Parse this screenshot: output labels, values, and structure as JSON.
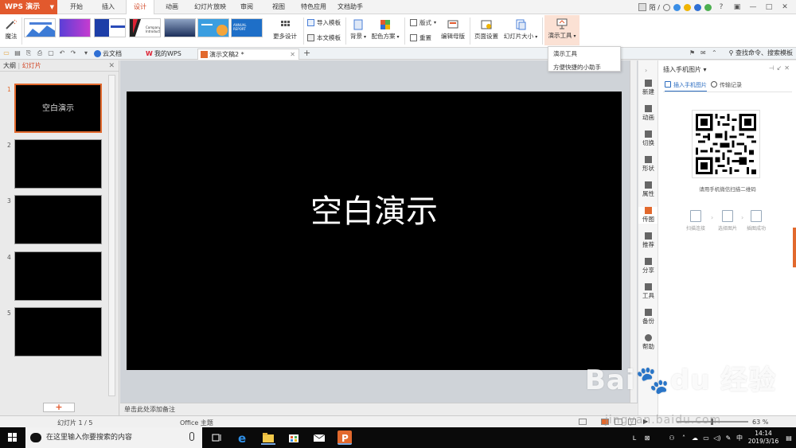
{
  "menubar": {
    "app_name": "WPS 演示",
    "tabs": [
      "开始",
      "插入",
      "设计",
      "动画",
      "幻灯片放映",
      "审阅",
      "视图",
      "特色应用",
      "文档助手"
    ],
    "active_tab": "设计",
    "user_name": "陌 /"
  },
  "ribbon": {
    "magic_label": "魔法",
    "more_design_label": "更多设计",
    "import_template_label": "导入模板",
    "this_template_label": "本文模板",
    "background_label": "背景",
    "color_scheme_label": "配色方案",
    "layout_label": "版式",
    "reset_label": "重置",
    "edit_master_label": "编辑母版",
    "page_setup_label": "页面设置",
    "slide_size_label": "幻灯片大小",
    "present_tools_label": "演示工具",
    "template_thumbs": [
      "",
      "",
      "",
      "Company Introduction",
      "",
      "",
      "ANNUAL REPORT",
      ""
    ]
  },
  "dropdown": {
    "items": [
      "演示工具",
      "方便快捷的小助手"
    ]
  },
  "tabbar": {
    "tabs": [
      {
        "label": "云文档",
        "active": false
      },
      {
        "label": "我的WPS",
        "active": false
      },
      {
        "label": "演示文稿2 *",
        "active": true
      }
    ],
    "add_label": "+",
    "command_search": "查找命令、搜索模板"
  },
  "leftpanel": {
    "outline_label": "大纲",
    "slides_label": "幻灯片",
    "slides": [
      {
        "num": "1",
        "text": "空白演示",
        "selected": true
      },
      {
        "num": "2",
        "text": "",
        "selected": false
      },
      {
        "num": "3",
        "text": "",
        "selected": false
      },
      {
        "num": "4",
        "text": "",
        "selected": false
      },
      {
        "num": "5",
        "text": "",
        "selected": false
      }
    ],
    "add_button": "+"
  },
  "main": {
    "slide_title": "空白演示",
    "notes_placeholder": "单击此处添加备注"
  },
  "toolstrip": {
    "tools": [
      {
        "label": "新建",
        "active": false
      },
      {
        "label": "动画",
        "active": false
      },
      {
        "label": "切换",
        "active": false
      },
      {
        "label": "形状",
        "active": false
      },
      {
        "label": "属性",
        "active": false
      },
      {
        "label": "传图",
        "active": true
      },
      {
        "label": "推荐",
        "active": false
      },
      {
        "label": "分享",
        "active": false
      },
      {
        "label": "工具",
        "active": false
      },
      {
        "label": "备份",
        "active": false
      },
      {
        "label": "帮助",
        "active": false
      }
    ]
  },
  "rightpanel": {
    "title": "插入手机图片",
    "tab_insert": "插入手机图片",
    "tab_history": "传输记录",
    "hint": "请用手机微信扫描二维码",
    "steps": [
      "扫描连接",
      "选择图片",
      "插图成功"
    ]
  },
  "statusbar": {
    "slide_info": "幻灯片 1 / 5",
    "theme": "Office 主题",
    "zoom": "63 %"
  },
  "taskbar": {
    "search_placeholder": "在这里输入你要搜索的内容",
    "time": "14:14",
    "date": "2019/3/16",
    "ime": "中"
  },
  "watermark": {
    "brand": "Bai du 经验",
    "url": "jingyan.baidu.com"
  }
}
